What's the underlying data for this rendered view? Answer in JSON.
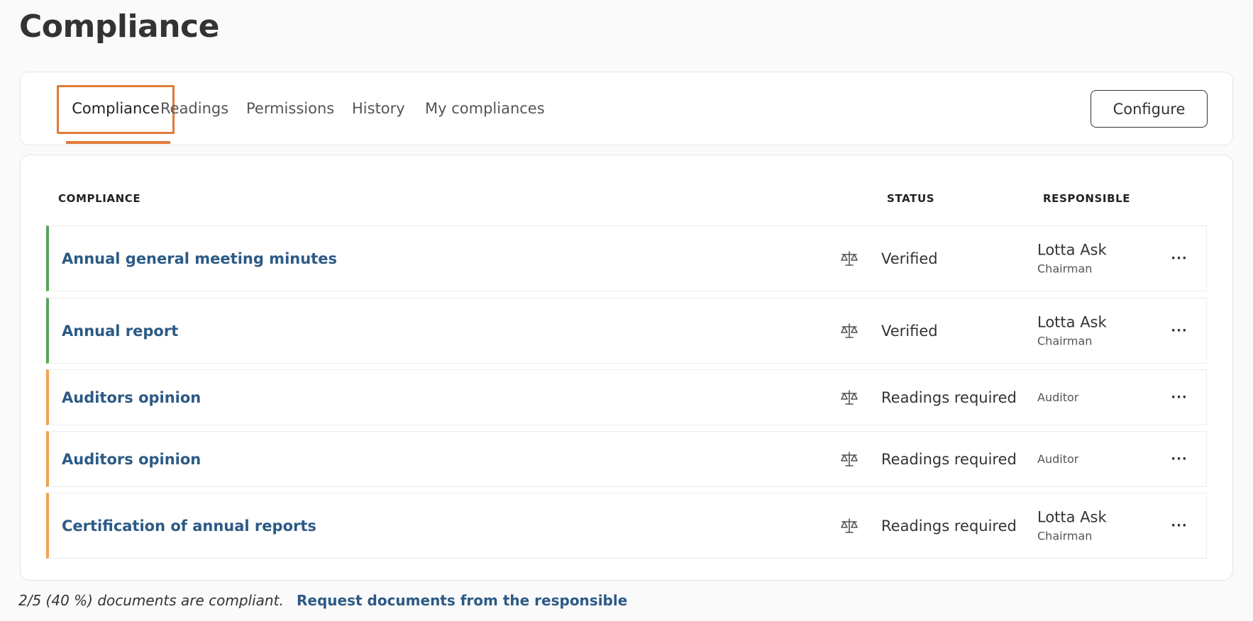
{
  "page": {
    "title": "Compliance"
  },
  "tabs": [
    {
      "label": "Compliance",
      "active": true
    },
    {
      "label": "Readings",
      "active": false
    },
    {
      "label": "Permissions",
      "active": false
    },
    {
      "label": "History",
      "active": false
    },
    {
      "label": "My compliances",
      "active": false
    }
  ],
  "toolbar": {
    "configure_label": "Configure"
  },
  "table": {
    "headers": {
      "compliance": "COMPLIANCE",
      "status": "STATUS",
      "responsible": "RESPONSIBLE"
    },
    "rows": [
      {
        "name": "Annual general meeting minutes",
        "status": "Verified",
        "responsible_name": "Lotta Ask",
        "responsible_role": "Chairman",
        "state": "ok",
        "icon": "scales-icon",
        "menu": "···"
      },
      {
        "name": "Annual report",
        "status": "Verified",
        "responsible_name": "Lotta Ask",
        "responsible_role": "Chairman",
        "state": "ok",
        "icon": "scales-icon",
        "menu": "···"
      },
      {
        "name": "Auditors opinion",
        "status": "Readings required",
        "responsible_name": "",
        "responsible_role": "Auditor",
        "state": "warn",
        "icon": "scales-icon",
        "menu": "···"
      },
      {
        "name": "Auditors opinion",
        "status": "Readings required",
        "responsible_name": "",
        "responsible_role": "Auditor",
        "state": "warn",
        "icon": "scales-icon",
        "menu": "···"
      },
      {
        "name": "Certification of annual reports",
        "status": "Readings required",
        "responsible_name": "Lotta Ask",
        "responsible_role": "Chairman",
        "state": "warn",
        "icon": "scales-icon",
        "menu": "···"
      }
    ]
  },
  "footer": {
    "summary": "2/5 (40 %) documents are compliant.",
    "link": "Request documents from the responsible"
  },
  "colors": {
    "accent": "#e07b39",
    "link": "#2c5a85",
    "ok": "#5aa55a",
    "warn": "#f0a34c"
  }
}
